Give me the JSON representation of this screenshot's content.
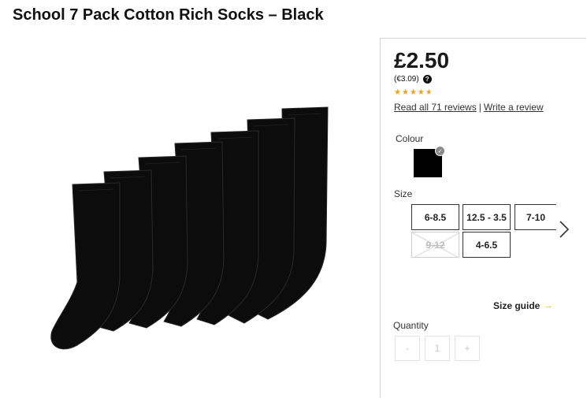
{
  "product": {
    "title": "School 7 Pack Cotton Rich Socks – Black",
    "image_icon": "socks-product-image"
  },
  "price": {
    "main": "£2.50",
    "euro": "(€3.09)",
    "help_icon": "?"
  },
  "rating": {
    "stars_out_of_5": 4.6,
    "read_reviews": "Read all 71 reviews",
    "separator": "|",
    "write_review": "Write a review"
  },
  "colour": {
    "label": "Colour",
    "selected_hex": "#000000"
  },
  "size": {
    "label": "Size",
    "options": [
      {
        "label": "6-8.5",
        "available": true
      },
      {
        "label": "12.5 - 3.5",
        "available": true
      },
      {
        "label": "7-10",
        "available": true
      },
      {
        "label": "9-12",
        "available": false
      },
      {
        "label": "4-6.5",
        "available": true
      }
    ],
    "guide": "Size guide",
    "guide_arrow": "→"
  },
  "quantity": {
    "label": "Quantity",
    "minus": "-",
    "value": "1",
    "plus": "+"
  },
  "colors": {
    "star": "#f0a500",
    "border": "#d4d4d4"
  }
}
